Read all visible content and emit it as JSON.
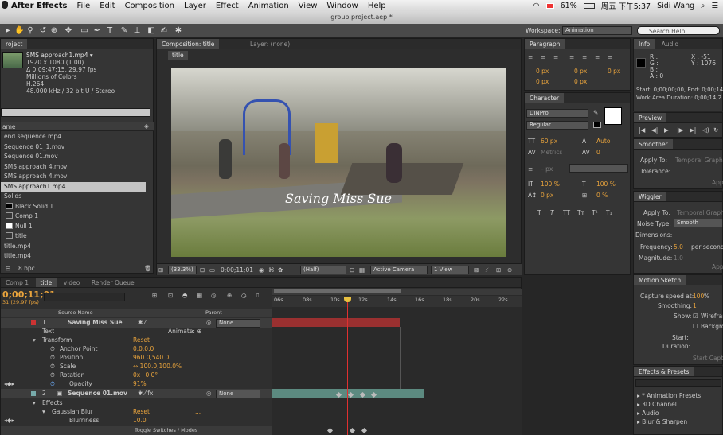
{
  "menubar": {
    "app": "After Effects",
    "items": [
      "File",
      "Edit",
      "Composition",
      "Layer",
      "Effect",
      "Animation",
      "View",
      "Window",
      "Help"
    ],
    "battery": "61%",
    "datetime": "周五 下午5:37",
    "user": "Sidi Wang"
  },
  "window_title": "group project.aep *",
  "workspace": {
    "label": "Workspace:",
    "value": "Animation",
    "search_placeholder": "Search Help"
  },
  "project": {
    "tab": "roject",
    "file_name": "SMS approach1.mp4 ▾",
    "file_info": [
      "1920 x 1080 (1.00)",
      "Δ 0;09;47;15, 29.97 fps",
      "Millions of Colors",
      "H.264",
      "48.000 kHz / 32 bit U / Stereo"
    ],
    "col_name": "ame",
    "items": [
      {
        "label": "end sequence.mp4",
        "type": "file"
      },
      {
        "label": "Sequence 01_1.mov",
        "type": "file"
      },
      {
        "label": "Sequence 01.mov",
        "type": "file"
      },
      {
        "label": "SMS approach 4.mov",
        "type": "file"
      },
      {
        "label": "SMS approach 4.mov",
        "type": "file"
      },
      {
        "label": "SMS approach1.mp4",
        "type": "file",
        "selected": true
      },
      {
        "label": "Solids",
        "type": "folder"
      },
      {
        "label": "Black Solid 1",
        "type": "solid-black"
      },
      {
        "label": "Comp 1",
        "type": "comp"
      },
      {
        "label": "Null 1",
        "type": "solid-white"
      },
      {
        "label": "title",
        "type": "comp"
      },
      {
        "label": "title.mp4",
        "type": "file"
      },
      {
        "label": "title.mp4",
        "type": "file"
      }
    ],
    "bpc": "8 bpc"
  },
  "composition": {
    "tabs": [
      "Composition: title",
      "Layer: (none)"
    ],
    "comp_tab": "title",
    "overlay_text": "Saving Miss Sue",
    "zoom": "(33.3%)",
    "timecode": "0;00;11;01",
    "resolution": "(Half)",
    "camera": "Active Camera",
    "views": "1 View"
  },
  "paragraph": {
    "tab": "Paragraph",
    "values": [
      "0 px",
      "0 px",
      "0 px",
      "0 px",
      "0 px"
    ]
  },
  "character": {
    "tab": "Character",
    "font": "DINPro",
    "style": "Regular",
    "size": "60 px",
    "leading": "Auto",
    "kerning": "Metrics",
    "tracking": "0",
    "stroke": "– px",
    "vscale": "100 %",
    "hscale": "100 %",
    "baseline": "0 px",
    "tsume": "0 %",
    "styles": [
      "T",
      "T",
      "TT",
      "Tт",
      "T¹",
      "T₁"
    ]
  },
  "info": {
    "tabs": [
      "Info",
      "Audio"
    ],
    "rgba": [
      "R :",
      "G :",
      "B :",
      "A : 0"
    ],
    "x": "X : -51",
    "y": "Y : 1076",
    "start": "Start: 0;00;00;00, End: 0;00;14;2",
    "duration": "Work Area Duration: 0;00;14;2"
  },
  "preview": {
    "tab": "Preview"
  },
  "smoother": {
    "tab": "Smoother",
    "apply_to": "Apply To:",
    "apply_val": "Temporal Graph",
    "tolerance": "Tolerance:",
    "tolerance_val": "1",
    "apply_btn": "Appl"
  },
  "wiggler": {
    "tab": "Wiggler",
    "apply_to": "Apply To:",
    "apply_val": "Temporal Graph",
    "noise_type": "Noise Type:",
    "noise_val": "Smooth",
    "dimensions": "Dimensions:",
    "frequency": "Frequency:",
    "frequency_val": "5.0",
    "frequency_unit": "per second",
    "magnitude": "Magnitude:",
    "magnitude_val": "1.0",
    "apply_btn": "Appl"
  },
  "motion_sketch": {
    "tab": "Motion Sketch",
    "capture": "Capture speed at:",
    "capture_val": "100",
    "capture_unit": "%",
    "smoothing": "Smoothing:",
    "smoothing_val": "1",
    "show": "Show:",
    "wireframe": "Wirefran",
    "background": "Backgro",
    "start": "Start:",
    "duration": "Duration:",
    "capture_btn": "Start Captu"
  },
  "effects_presets": {
    "tab": "Effects & Presets",
    "items": [
      "* Animation Presets",
      "3D Channel",
      "Audio",
      "Blur & Sharpen"
    ]
  },
  "timeline": {
    "tabs": [
      "Comp 1",
      "title",
      "video",
      "Render Queue"
    ],
    "timecode": "0;00;11;01",
    "fps": "31 (29.97 fps)",
    "col_source": "Source Name",
    "col_parent": "Parent",
    "ruler": [
      "06s",
      "08s",
      "10s",
      "12s",
      "14s",
      "16s",
      "18s",
      "20s",
      "22s"
    ],
    "toggle_label": "Toggle Switches / Modes",
    "layers": [
      {
        "num": "1",
        "name": "Saving Miss Sue",
        "parent": "None"
      },
      {
        "num": "2",
        "name": "Sequence 01.mov",
        "parent": "None"
      }
    ],
    "props": [
      {
        "label": "Text",
        "value": "",
        "extra": "Animate: ⊕"
      },
      {
        "label": "Transform",
        "value": "Reset"
      },
      {
        "label": "Anchor Point",
        "value": "0.0,0.0"
      },
      {
        "label": "Position",
        "value": "960.0,540.0"
      },
      {
        "label": "Scale",
        "value": "⇔ 100.0,100.0%"
      },
      {
        "label": "Rotation",
        "value": "0x+0.0°"
      },
      {
        "label": "Opacity",
        "value": "91%"
      }
    ],
    "props2": [
      {
        "label": "Effects",
        "value": ""
      },
      {
        "label": "Gaussian Blur",
        "value": "Reset",
        "extra": "..."
      },
      {
        "label": "Blurriness",
        "value": "10.0"
      }
    ]
  }
}
